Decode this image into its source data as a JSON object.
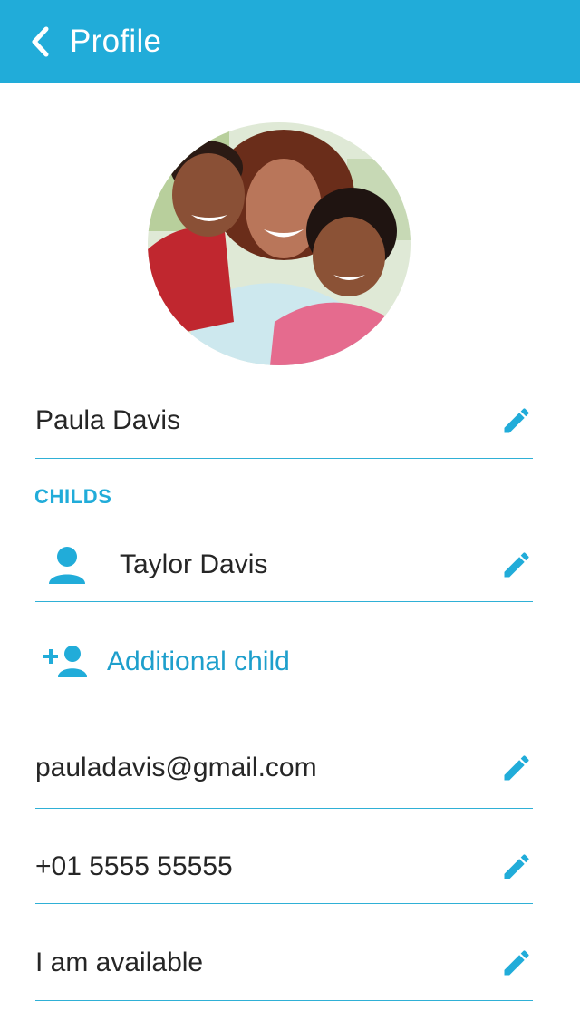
{
  "header": {
    "title": "Profile",
    "back_icon": "chevron-left-icon",
    "background_color": "#21acd9"
  },
  "profile": {
    "avatar_icon": "profile-photo",
    "name": "Paula Davis"
  },
  "children_section": {
    "label": "CHILDS",
    "children": [
      {
        "name": "Taylor Davis",
        "icon": "person-icon"
      }
    ],
    "add_child_label": "Additional child",
    "add_child_icon": "add-person-icon"
  },
  "contact": {
    "email": "pauladavis@gmail.com",
    "phone": "+01 5555 55555",
    "status": "I am available"
  },
  "colors": {
    "accent": "#21acd9",
    "divider": "#2fb0d6",
    "text": "#262626"
  }
}
